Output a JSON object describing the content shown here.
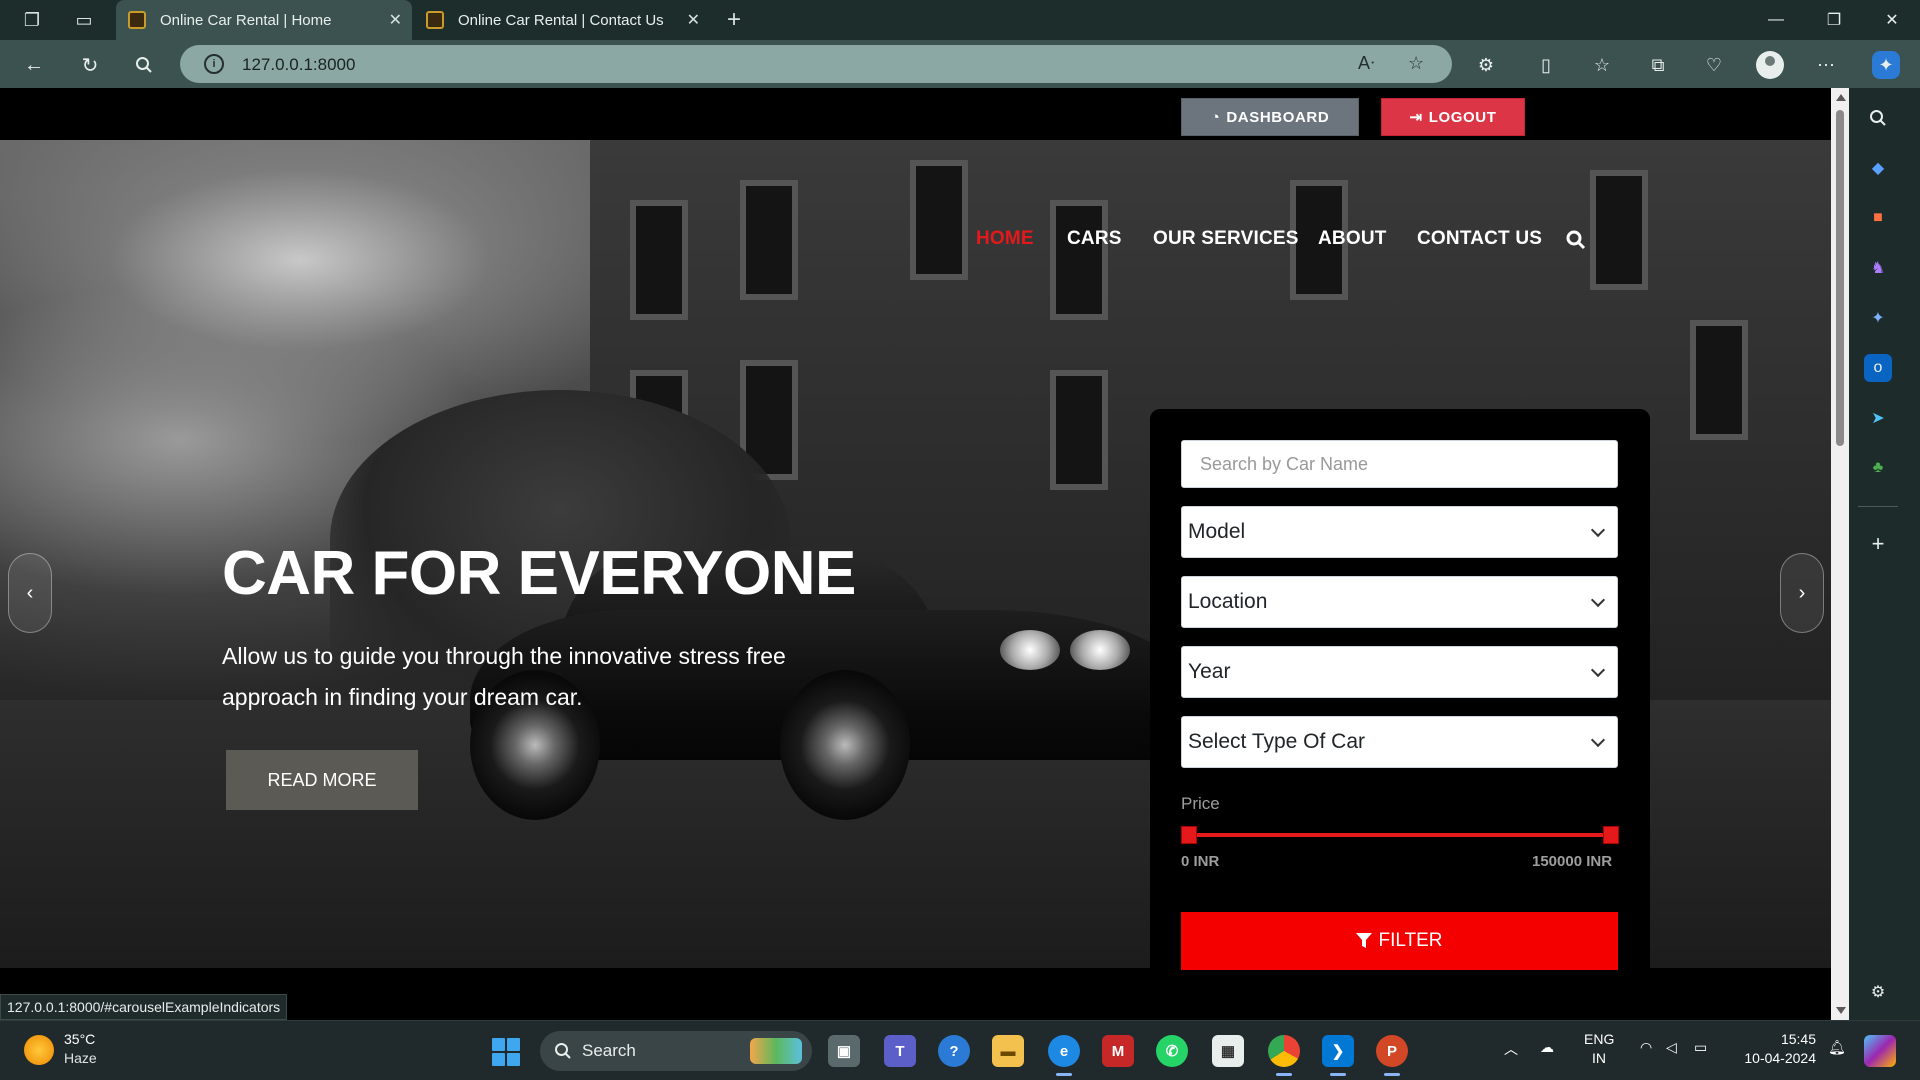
{
  "browser": {
    "tabs": [
      {
        "title": "Online Car Rental | Home",
        "active": true
      },
      {
        "title": "Online Car Rental | Contact Us",
        "active": false
      }
    ],
    "url": "127.0.0.1:8000",
    "status_url": "127.0.0.1:8000/#carouselExampleIndicators"
  },
  "topbar": {
    "dashboard_label": "DASHBOARD",
    "logout_label": "LOGOUT"
  },
  "nav": {
    "items": [
      {
        "label": "HOME",
        "active": true
      },
      {
        "label": "CARS"
      },
      {
        "label": "OUR SERVICES"
      },
      {
        "label": "ABOUT"
      },
      {
        "label": "CONTACT US"
      }
    ]
  },
  "hero": {
    "title": "CAR FOR EVERYONE",
    "subtitle": "Allow us to guide you through the innovative stress free approach in finding your dream car.",
    "cta_label": "READ MORE"
  },
  "filter": {
    "search_placeholder": "Search by Car Name",
    "model": "Model",
    "location": "Location",
    "year": "Year",
    "car_type": "Select Type Of Car",
    "price_label": "Price",
    "price_min": "0 INR",
    "price_max": "150000 INR",
    "button_label": "FILTER"
  },
  "taskbar": {
    "temperature": "35°C",
    "weather": "Haze",
    "search_label": "Search",
    "lang_top": "ENG",
    "lang_bottom": "IN",
    "time": "15:45",
    "date": "10-04-2024"
  },
  "colors": {
    "accent_red": "#e4191b",
    "filter_red": "#f40000",
    "logout_red": "#dc3545",
    "dashboard_gray": "#6c757d"
  }
}
